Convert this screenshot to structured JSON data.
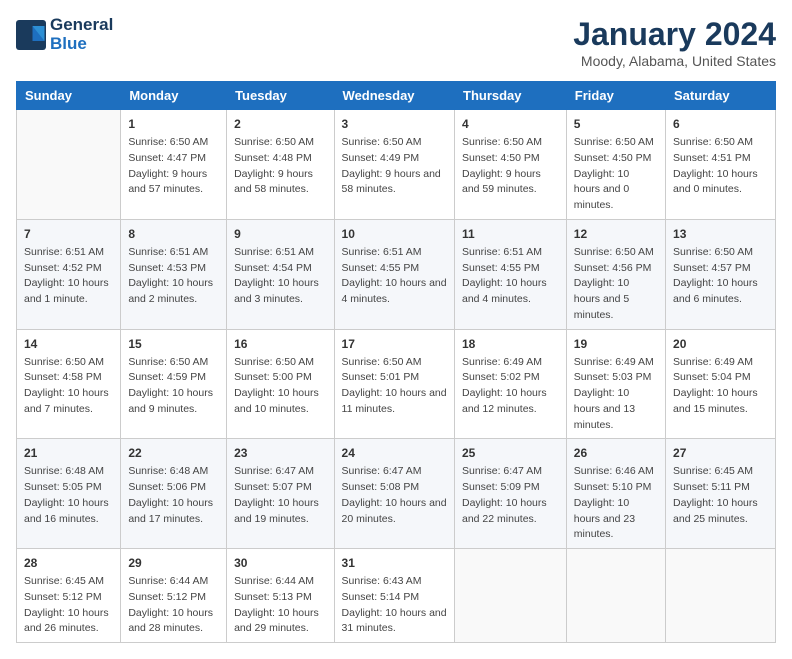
{
  "header": {
    "logo_line1": "General",
    "logo_line2": "Blue",
    "title": "January 2024",
    "subtitle": "Moody, Alabama, United States"
  },
  "days_of_week": [
    "Sunday",
    "Monday",
    "Tuesday",
    "Wednesday",
    "Thursday",
    "Friday",
    "Saturday"
  ],
  "weeks": [
    [
      {
        "day": "",
        "sunrise": "",
        "sunset": "",
        "daylight": ""
      },
      {
        "day": "1",
        "sunrise": "Sunrise: 6:50 AM",
        "sunset": "Sunset: 4:47 PM",
        "daylight": "Daylight: 9 hours and 57 minutes."
      },
      {
        "day": "2",
        "sunrise": "Sunrise: 6:50 AM",
        "sunset": "Sunset: 4:48 PM",
        "daylight": "Daylight: 9 hours and 58 minutes."
      },
      {
        "day": "3",
        "sunrise": "Sunrise: 6:50 AM",
        "sunset": "Sunset: 4:49 PM",
        "daylight": "Daylight: 9 hours and 58 minutes."
      },
      {
        "day": "4",
        "sunrise": "Sunrise: 6:50 AM",
        "sunset": "Sunset: 4:50 PM",
        "daylight": "Daylight: 9 hours and 59 minutes."
      },
      {
        "day": "5",
        "sunrise": "Sunrise: 6:50 AM",
        "sunset": "Sunset: 4:50 PM",
        "daylight": "Daylight: 10 hours and 0 minutes."
      },
      {
        "day": "6",
        "sunrise": "Sunrise: 6:50 AM",
        "sunset": "Sunset: 4:51 PM",
        "daylight": "Daylight: 10 hours and 0 minutes."
      }
    ],
    [
      {
        "day": "7",
        "sunrise": "Sunrise: 6:51 AM",
        "sunset": "Sunset: 4:52 PM",
        "daylight": "Daylight: 10 hours and 1 minute."
      },
      {
        "day": "8",
        "sunrise": "Sunrise: 6:51 AM",
        "sunset": "Sunset: 4:53 PM",
        "daylight": "Daylight: 10 hours and 2 minutes."
      },
      {
        "day": "9",
        "sunrise": "Sunrise: 6:51 AM",
        "sunset": "Sunset: 4:54 PM",
        "daylight": "Daylight: 10 hours and 3 minutes."
      },
      {
        "day": "10",
        "sunrise": "Sunrise: 6:51 AM",
        "sunset": "Sunset: 4:55 PM",
        "daylight": "Daylight: 10 hours and 4 minutes."
      },
      {
        "day": "11",
        "sunrise": "Sunrise: 6:51 AM",
        "sunset": "Sunset: 4:55 PM",
        "daylight": "Daylight: 10 hours and 4 minutes."
      },
      {
        "day": "12",
        "sunrise": "Sunrise: 6:50 AM",
        "sunset": "Sunset: 4:56 PM",
        "daylight": "Daylight: 10 hours and 5 minutes."
      },
      {
        "day": "13",
        "sunrise": "Sunrise: 6:50 AM",
        "sunset": "Sunset: 4:57 PM",
        "daylight": "Daylight: 10 hours and 6 minutes."
      }
    ],
    [
      {
        "day": "14",
        "sunrise": "Sunrise: 6:50 AM",
        "sunset": "Sunset: 4:58 PM",
        "daylight": "Daylight: 10 hours and 7 minutes."
      },
      {
        "day": "15",
        "sunrise": "Sunrise: 6:50 AM",
        "sunset": "Sunset: 4:59 PM",
        "daylight": "Daylight: 10 hours and 9 minutes."
      },
      {
        "day": "16",
        "sunrise": "Sunrise: 6:50 AM",
        "sunset": "Sunset: 5:00 PM",
        "daylight": "Daylight: 10 hours and 10 minutes."
      },
      {
        "day": "17",
        "sunrise": "Sunrise: 6:50 AM",
        "sunset": "Sunset: 5:01 PM",
        "daylight": "Daylight: 10 hours and 11 minutes."
      },
      {
        "day": "18",
        "sunrise": "Sunrise: 6:49 AM",
        "sunset": "Sunset: 5:02 PM",
        "daylight": "Daylight: 10 hours and 12 minutes."
      },
      {
        "day": "19",
        "sunrise": "Sunrise: 6:49 AM",
        "sunset": "Sunset: 5:03 PM",
        "daylight": "Daylight: 10 hours and 13 minutes."
      },
      {
        "day": "20",
        "sunrise": "Sunrise: 6:49 AM",
        "sunset": "Sunset: 5:04 PM",
        "daylight": "Daylight: 10 hours and 15 minutes."
      }
    ],
    [
      {
        "day": "21",
        "sunrise": "Sunrise: 6:48 AM",
        "sunset": "Sunset: 5:05 PM",
        "daylight": "Daylight: 10 hours and 16 minutes."
      },
      {
        "day": "22",
        "sunrise": "Sunrise: 6:48 AM",
        "sunset": "Sunset: 5:06 PM",
        "daylight": "Daylight: 10 hours and 17 minutes."
      },
      {
        "day": "23",
        "sunrise": "Sunrise: 6:47 AM",
        "sunset": "Sunset: 5:07 PM",
        "daylight": "Daylight: 10 hours and 19 minutes."
      },
      {
        "day": "24",
        "sunrise": "Sunrise: 6:47 AM",
        "sunset": "Sunset: 5:08 PM",
        "daylight": "Daylight: 10 hours and 20 minutes."
      },
      {
        "day": "25",
        "sunrise": "Sunrise: 6:47 AM",
        "sunset": "Sunset: 5:09 PM",
        "daylight": "Daylight: 10 hours and 22 minutes."
      },
      {
        "day": "26",
        "sunrise": "Sunrise: 6:46 AM",
        "sunset": "Sunset: 5:10 PM",
        "daylight": "Daylight: 10 hours and 23 minutes."
      },
      {
        "day": "27",
        "sunrise": "Sunrise: 6:45 AM",
        "sunset": "Sunset: 5:11 PM",
        "daylight": "Daylight: 10 hours and 25 minutes."
      }
    ],
    [
      {
        "day": "28",
        "sunrise": "Sunrise: 6:45 AM",
        "sunset": "Sunset: 5:12 PM",
        "daylight": "Daylight: 10 hours and 26 minutes."
      },
      {
        "day": "29",
        "sunrise": "Sunrise: 6:44 AM",
        "sunset": "Sunset: 5:12 PM",
        "daylight": "Daylight: 10 hours and 28 minutes."
      },
      {
        "day": "30",
        "sunrise": "Sunrise: 6:44 AM",
        "sunset": "Sunset: 5:13 PM",
        "daylight": "Daylight: 10 hours and 29 minutes."
      },
      {
        "day": "31",
        "sunrise": "Sunrise: 6:43 AM",
        "sunset": "Sunset: 5:14 PM",
        "daylight": "Daylight: 10 hours and 31 minutes."
      },
      {
        "day": "",
        "sunrise": "",
        "sunset": "",
        "daylight": ""
      },
      {
        "day": "",
        "sunrise": "",
        "sunset": "",
        "daylight": ""
      },
      {
        "day": "",
        "sunrise": "",
        "sunset": "",
        "daylight": ""
      }
    ]
  ]
}
